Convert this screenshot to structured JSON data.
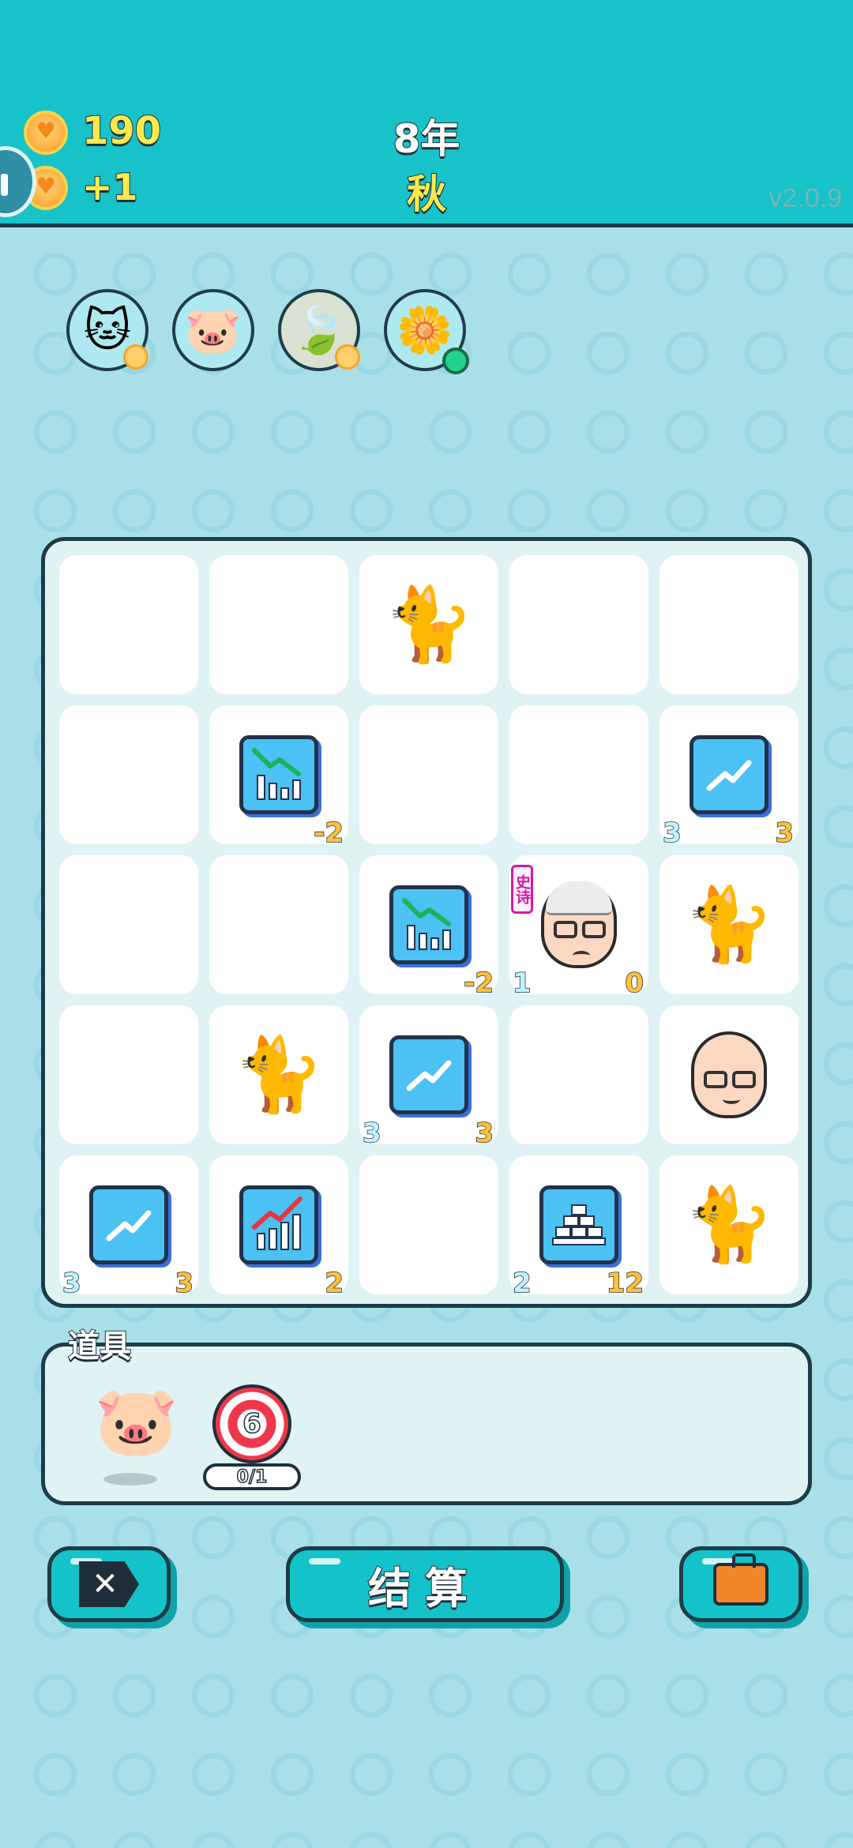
{
  "header": {
    "coins": "190",
    "income": "+1",
    "year": "8年",
    "season": "秋",
    "version": "v2.0.9"
  },
  "status_icons": [
    {
      "icon": "cat-eating-icon",
      "badge": "coin"
    },
    {
      "icon": "piggy-bank-icon",
      "badge": ""
    },
    {
      "icon": "leaf-icon",
      "badge": "coin"
    },
    {
      "icon": "flower-pot-icon",
      "badge": "green-dot"
    }
  ],
  "board": {
    "rows": [
      [
        {
          "type": "empty"
        },
        {
          "type": "empty"
        },
        {
          "type": "cat",
          "icon": "cat-icon"
        },
        {
          "type": "empty"
        },
        {
          "type": "empty"
        }
      ],
      [
        {
          "type": "empty"
        },
        {
          "type": "chart-down",
          "icon": "chart-down-icon",
          "left": "",
          "right": "-2"
        },
        {
          "type": "empty"
        },
        {
          "type": "empty"
        },
        {
          "type": "trend-up",
          "icon": "trend-up-icon",
          "left": "3",
          "right": "3"
        }
      ],
      [
        {
          "type": "empty"
        },
        {
          "type": "empty"
        },
        {
          "type": "chart-down",
          "icon": "chart-down-icon",
          "left": "",
          "right": "-2"
        },
        {
          "type": "old-man",
          "icon": "old-man-icon",
          "tag": "史诗",
          "left": "1",
          "right": "0"
        },
        {
          "type": "cat",
          "icon": "cat-icon"
        }
      ],
      [
        {
          "type": "empty"
        },
        {
          "type": "cat",
          "icon": "cat-icon"
        },
        {
          "type": "trend-up",
          "icon": "trend-up-icon",
          "left": "3",
          "right": "3"
        },
        {
          "type": "empty"
        },
        {
          "type": "bald-man",
          "icon": "bald-man-icon"
        }
      ],
      [
        {
          "type": "trend-up",
          "icon": "trend-up-icon",
          "left": "3",
          "right": "3"
        },
        {
          "type": "chart-up",
          "icon": "chart-up-icon",
          "left": "",
          "right": "2"
        },
        {
          "type": "empty"
        },
        {
          "type": "gold-bars",
          "icon": "gold-bars-icon",
          "left": "2",
          "right": "12"
        },
        {
          "type": "cat",
          "icon": "cat-icon"
        }
      ]
    ]
  },
  "items": {
    "title": "道具",
    "target_number": "6",
    "target_counter": "0/1"
  },
  "buttons": {
    "settle": "结算"
  },
  "colors": {
    "header_bg": "#17c2c8",
    "button_bg": "#14c3c9",
    "coin_text": "#ffe94d",
    "value_positive": "#ffc03b"
  }
}
